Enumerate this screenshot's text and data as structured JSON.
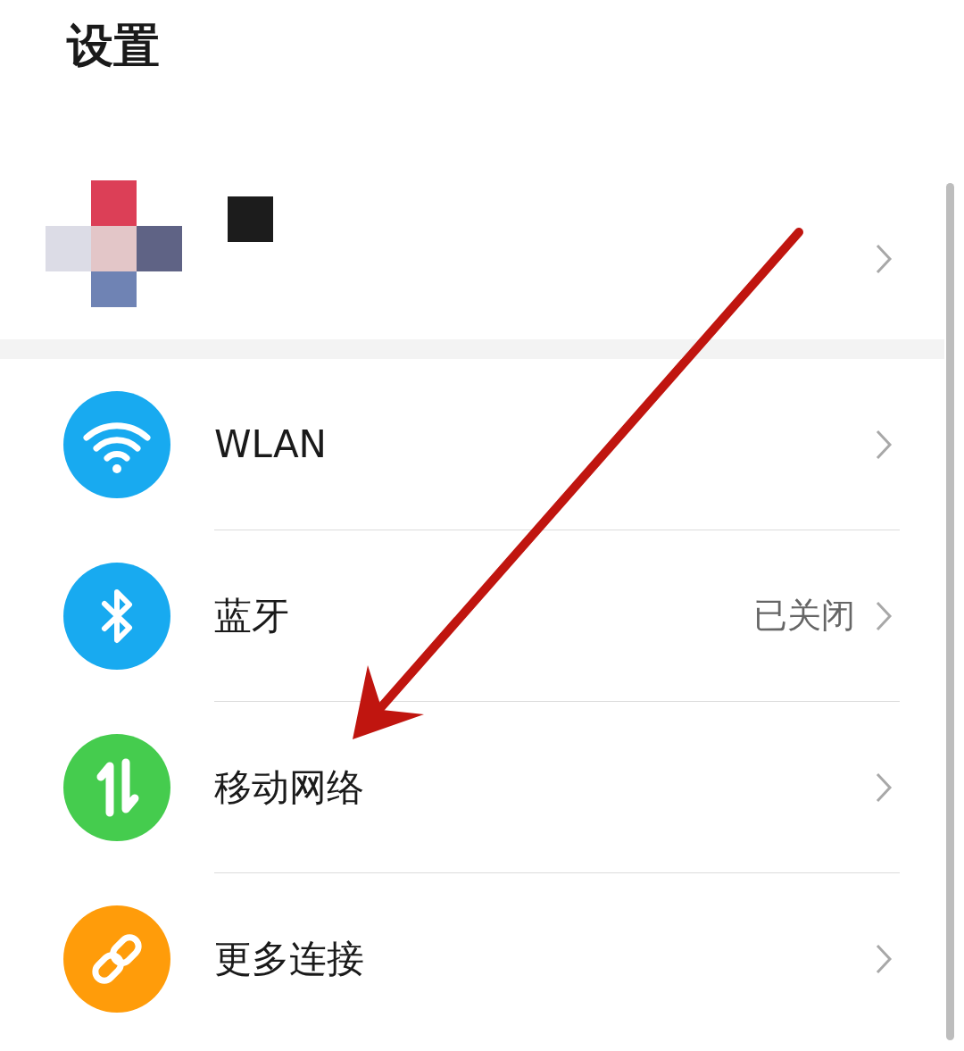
{
  "title": "设置",
  "items": [
    {
      "kind": "wifi",
      "label": "WLAN",
      "color": "#18aaf0"
    },
    {
      "kind": "bluetooth",
      "label": "蓝牙",
      "status": "已关闭",
      "color": "#18aaf0"
    },
    {
      "kind": "data",
      "label": "移动网络",
      "color": "#45cc4e"
    },
    {
      "kind": "link",
      "label": "更多连接",
      "color": "#ff9c0a"
    }
  ]
}
